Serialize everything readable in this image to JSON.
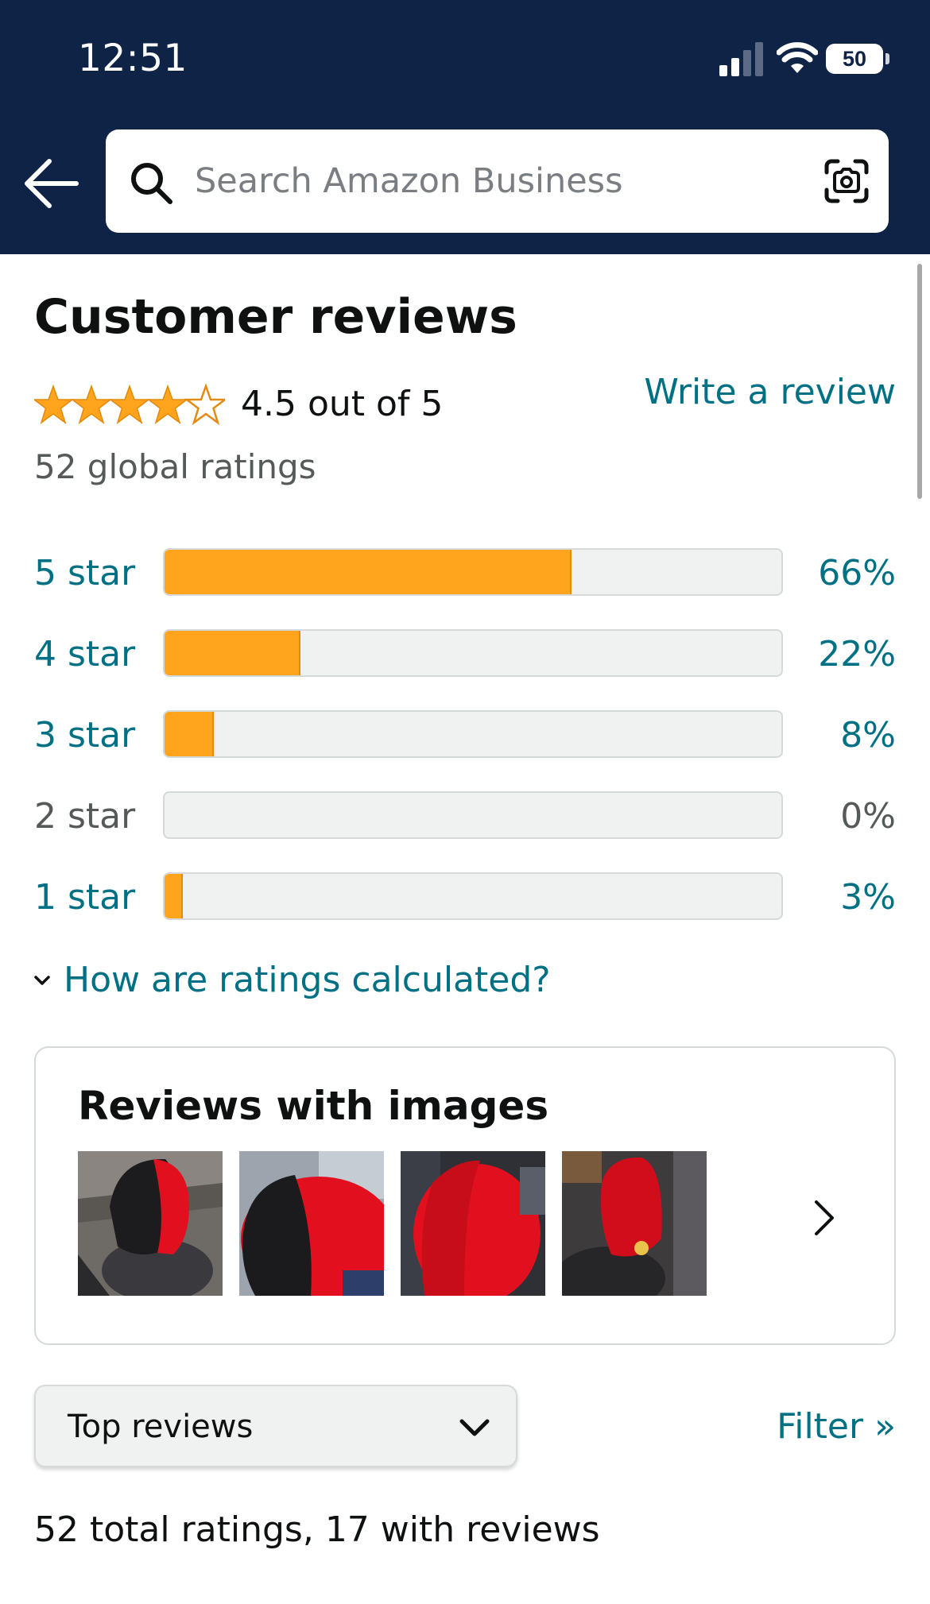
{
  "status_bar": {
    "time": "12:51",
    "battery": "50"
  },
  "search": {
    "placeholder": "Search Amazon Business"
  },
  "reviews": {
    "title": "Customer reviews",
    "rating": 4.5,
    "rating_text": "4.5 out of 5",
    "write_review": "Write a review",
    "global_ratings": "52 global ratings",
    "histogram": [
      {
        "label": "5 star",
        "percent": 66,
        "percent_text": "66%"
      },
      {
        "label": "4 star",
        "percent": 22,
        "percent_text": "22%"
      },
      {
        "label": "3 star",
        "percent": 8,
        "percent_text": "8%"
      },
      {
        "label": "2 star",
        "percent": 0,
        "percent_text": "0%"
      },
      {
        "label": "1 star",
        "percent": 3,
        "percent_text": "3%"
      }
    ],
    "how_calculated": "How are ratings calculated?"
  },
  "images_section": {
    "title": "Reviews with images"
  },
  "sort": {
    "selected": "Top reviews"
  },
  "filter_link": "Filter »",
  "total_summary": "52 total ratings, 17 with reviews",
  "colors": {
    "header_bg": "#0f2347",
    "link": "#007185",
    "star": "#ffa41c",
    "bar_fill": "#ffa41c"
  }
}
